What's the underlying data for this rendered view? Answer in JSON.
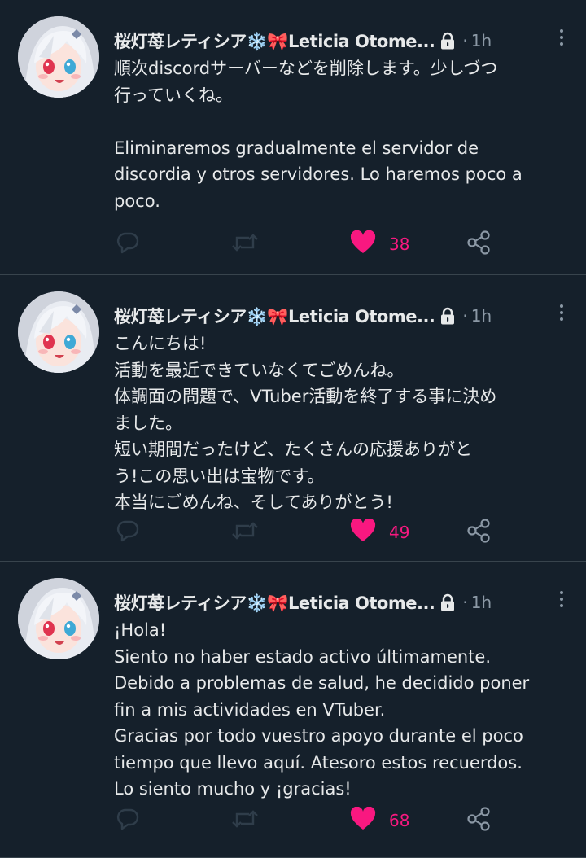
{
  "accent": {
    "like": "#f91880",
    "muted": "#8b98a5",
    "background": "#15202b"
  },
  "tweets": [
    {
      "author": "桜灯苺レティシア❄️🎀Leticia Otome...",
      "protected_icon": "lock-icon",
      "separator": "·",
      "time": "1h",
      "lines": [
        "順次discordサーバーなどを削除します。少しづつ",
        "行っていくね。",
        "",
        "Eliminaremos gradualmente el servidor de",
        "discordia y otros servidores. Lo haremos poco a",
        "poco."
      ],
      "likes": "38",
      "liked": true
    },
    {
      "author": "桜灯苺レティシア❄️🎀Leticia Otome...",
      "protected_icon": "lock-icon",
      "separator": "·",
      "time": "1h",
      "lines": [
        "こんにちは!",
        "活動を最近できていなくてごめんね。",
        "体調面の問題で、VTuber活動を終了する事に決め",
        "ました。",
        "短い期間だったけど、たくさんの応援ありがと",
        "う!この思い出は宝物です。",
        "本当にごめんね、そしてありがとう!"
      ],
      "likes": "49",
      "liked": true
    },
    {
      "author": "桜灯苺レティシア❄️🎀Leticia Otome...",
      "protected_icon": "lock-icon",
      "separator": "·",
      "time": "1h",
      "lines": [
        "¡Hola!",
        "Siento no haber estado activo últimamente.",
        "Debido a problemas de salud, he decidido poner",
        "fin a mis actividades en VTuber.",
        "Gracias por todo vuestro apoyo durante el poco",
        "tiempo que llevo aquí. Atesoro estos recuerdos.",
        "Lo siento mucho y ¡gracias!"
      ],
      "likes": "68",
      "liked": true
    }
  ]
}
